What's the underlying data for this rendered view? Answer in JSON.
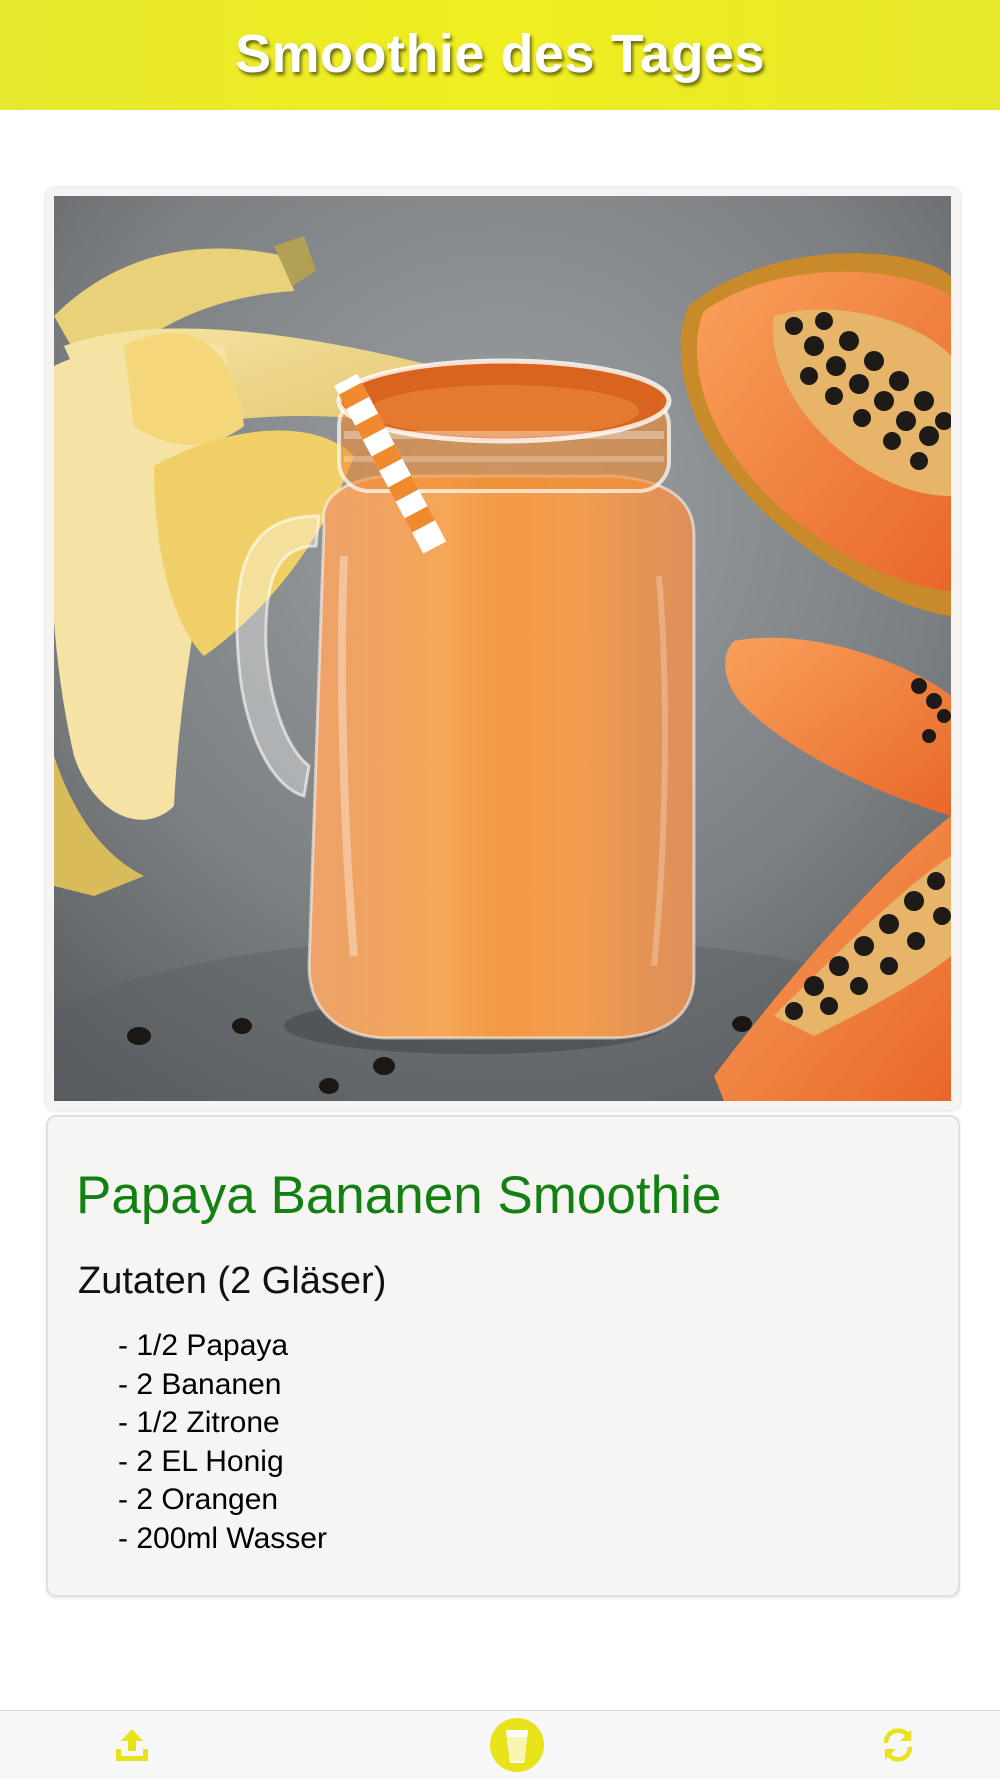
{
  "header": {
    "title": "Smoothie des Tages"
  },
  "recipe": {
    "title": "Papaya Bananen Smoothie",
    "ingredients_heading": "Zutaten (2 Gläser)",
    "ingredients": [
      "- 1/2 Papaya",
      "- 2 Bananen",
      "- 1/2 Zitrone",
      "- 2 EL Honig",
      "- 2 Orangen",
      "- 200ml Wasser"
    ]
  },
  "toolbar": {
    "items": [
      {
        "icon": "share-upload-icon"
      },
      {
        "icon": "smoothie-cup-icon"
      },
      {
        "icon": "refresh-icon"
      }
    ]
  },
  "colors": {
    "header_bg": "#efee1f",
    "title_green": "#138012",
    "icon_yellow": "#e8e21a"
  }
}
